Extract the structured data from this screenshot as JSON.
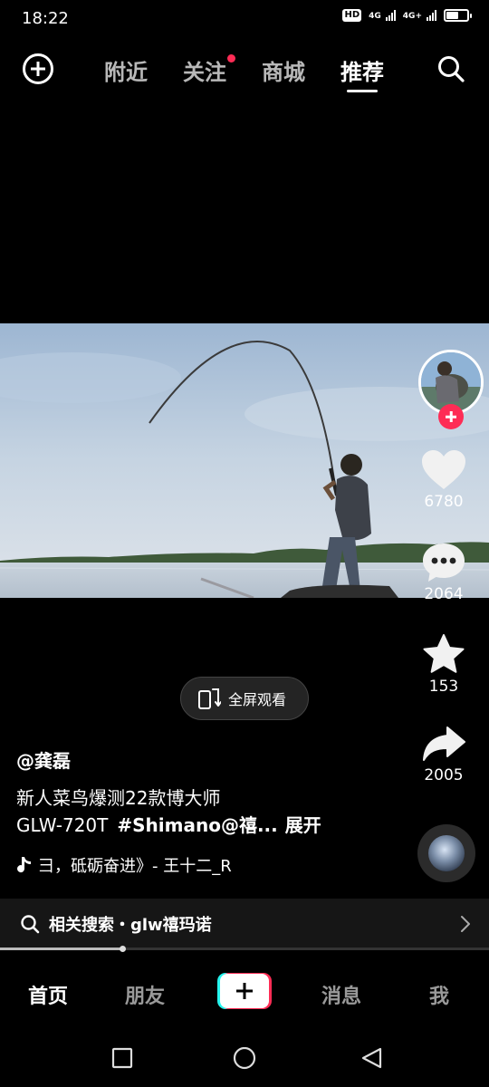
{
  "status_bar": {
    "time": "18:22",
    "hd_label": "HD",
    "network_1": "4G",
    "network_2": "4G+",
    "battery_level": 0.6
  },
  "top_nav": {
    "tabs": [
      {
        "label": "附近",
        "active": false
      },
      {
        "label": "关注",
        "active": false,
        "has_dot": true
      },
      {
        "label": "商城",
        "active": false
      },
      {
        "label": "推荐",
        "active": true
      }
    ],
    "icons": [
      "add-circle-icon",
      "search-icon"
    ]
  },
  "rail": {
    "likes": "6780",
    "comments": "2064",
    "favorites": "153",
    "shares": "2005"
  },
  "fullscreen_button": {
    "label": "全屏观看"
  },
  "caption": {
    "author": "@龚磊",
    "line1": "新人菜鸟爆测22款博大师",
    "line2_plain": "GLW-720T",
    "line2_tag": "#Shimano@禧...",
    "expand": "展开",
    "music": "彐，砥砺奋进》- 王十二_R"
  },
  "related_search": {
    "text": "相关搜索・glw禧玛诺"
  },
  "progress": {
    "fraction": 0.25
  },
  "bottom_nav": {
    "items": [
      {
        "label": "首页",
        "active": true
      },
      {
        "label": "朋友",
        "active": false
      },
      {
        "label": "消息",
        "active": false
      },
      {
        "label": "我",
        "active": false
      }
    ]
  },
  "colors": {
    "accent_red": "#fe2c55",
    "accent_cyan": "#25f4ee",
    "background": "#000000"
  }
}
